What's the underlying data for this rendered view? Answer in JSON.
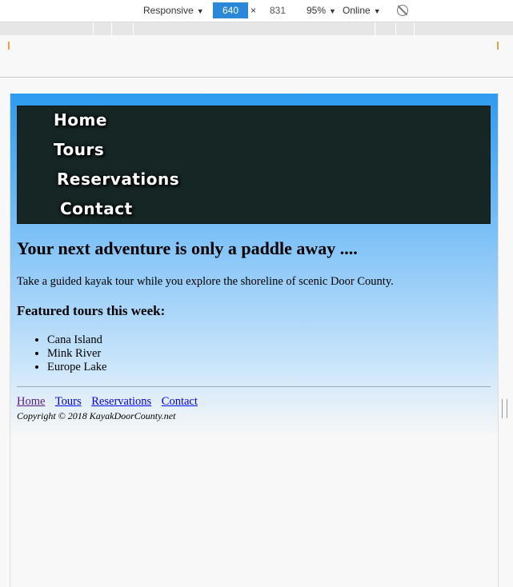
{
  "devtools": {
    "device_mode": "Responsive",
    "width": "640",
    "times": "×",
    "height": "831",
    "zoom": "95%",
    "network": "Online",
    "dropdown_arrow": "▼"
  },
  "site": {
    "nav": [
      "Home",
      "Tours",
      "Reservations",
      "Contact"
    ],
    "headline": "Your next adventure is only a paddle away ....",
    "intro": "Take a guided kayak tour while you explore the shoreline of scenic Door County.",
    "featured_heading": "Featured tours this week:",
    "featured_tours": [
      "Cana Island",
      "Mink River",
      "Europe Lake"
    ],
    "footer_nav": [
      "Home",
      "Tours",
      "Reservations",
      "Contact"
    ],
    "copyright": "Copyright © 2018 KayakDoorCounty.net"
  },
  "colors": {
    "nav_background": "#162625",
    "gradient_top": "#2d9bf0",
    "visited_link": "#551a8b",
    "link": "#0000ee"
  }
}
